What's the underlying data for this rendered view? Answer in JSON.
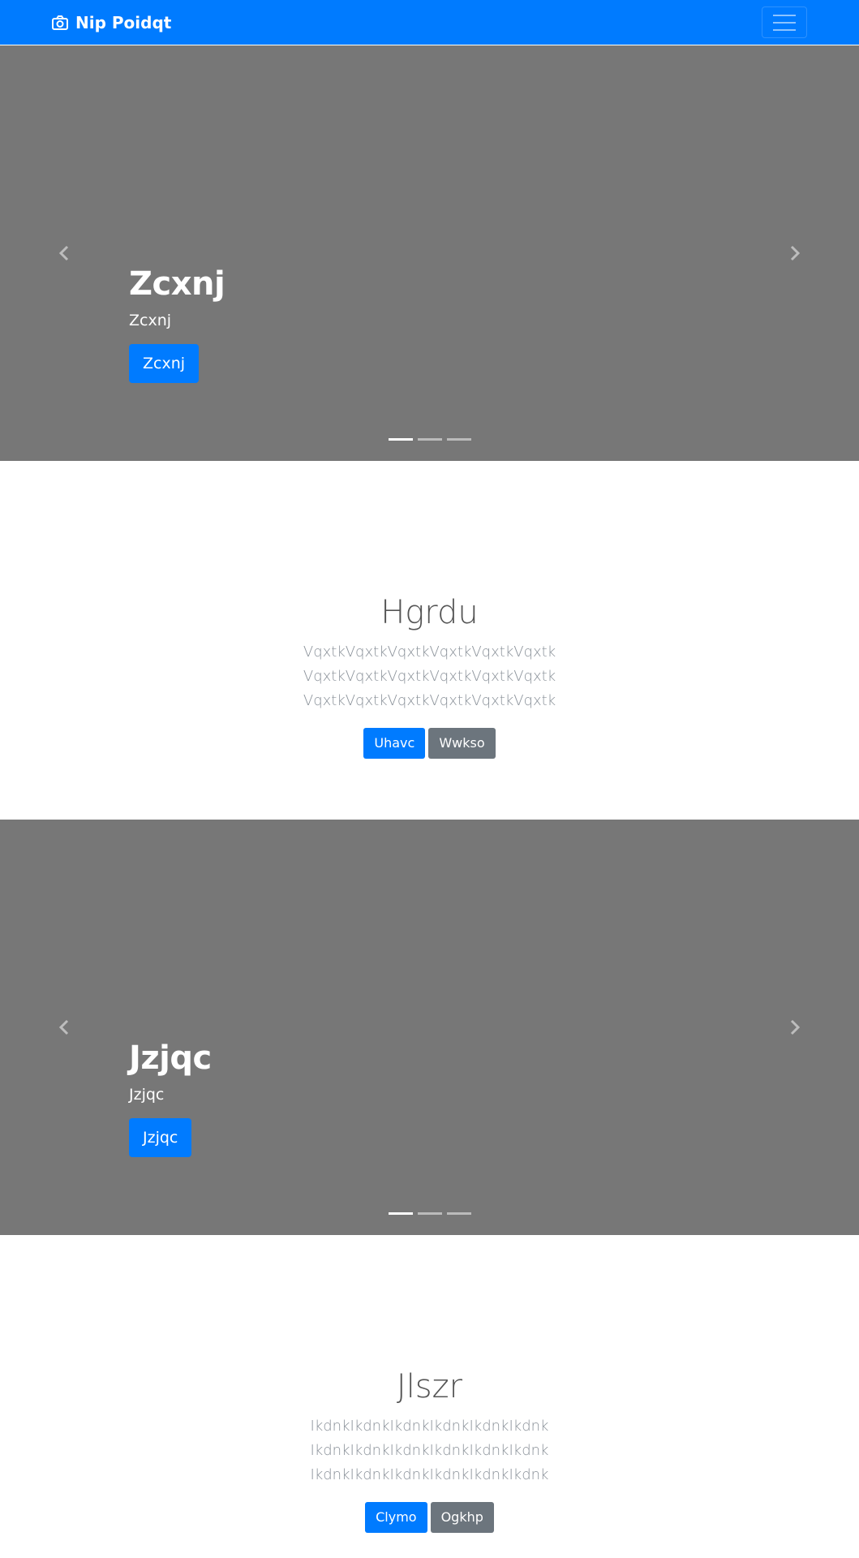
{
  "navbar": {
    "brand": "Nip Poidqt",
    "brand_icon": "camera-icon",
    "toggler_icon": "hamburger-menu-icon",
    "background": "#007bff"
  },
  "carousels": [
    {
      "title": "Zcxnj",
      "text": "Zcxnj",
      "button": "Zcxnj",
      "background": "#777777",
      "indicators": 3,
      "active_indicator": 0
    },
    {
      "title": "Jzjqc",
      "text": "Jzjqc",
      "button": "Jzjqc",
      "background": "#777777",
      "indicators": 3,
      "active_indicator": 0
    }
  ],
  "sections": [
    {
      "heading": "Hgrdu",
      "lead": "VqxtkVqxtkVqxtkVqxtkVqxtkVqxtk VqxtkVqxtkVqxtkVqxtkVqxtkVqxtk VqxtkVqxtkVqxtkVqxtkVqxtkVqxtk",
      "primary_button": "Uhavc",
      "secondary_button": "Wwkso"
    },
    {
      "heading": "Jlszr",
      "lead": "IkdnkIkdnkIkdnkIkdnkIkdnkIkdnk IkdnkIkdnkIkdnkIkdnkIkdnkIkdnk IkdnkIkdnkIkdnkIkdnkIkdnkIkdnk",
      "primary_button": "Clymo",
      "secondary_button": "Ogkhp"
    }
  ],
  "colors": {
    "primary": "#007bff",
    "secondary": "#6c757d",
    "carousel_bg": "#777777"
  }
}
